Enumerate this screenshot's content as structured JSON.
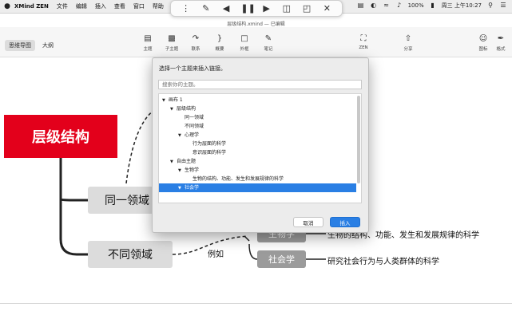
{
  "menubar": {
    "items": [
      "XMind ZEN",
      "文件",
      "编辑",
      "插入",
      "查看",
      "窗口",
      "帮助"
    ],
    "clock": "周三 上午10:27",
    "battery": "100%"
  },
  "window": {
    "title": "层级结构.xmind — 已编辑"
  },
  "toolbar": {
    "view_tabs": [
      "思维导图",
      "大纲"
    ],
    "tools": [
      "主题",
      "子主题",
      "联系",
      "概要",
      "外框",
      "笔记",
      "ZEN",
      "分享",
      "图标",
      "格式"
    ]
  },
  "mindmap": {
    "root": "层级结构",
    "topic1": "同一领域",
    "topic2": "不同领域",
    "relationship_label": "例如",
    "sub1": "生物学",
    "sub1_desc": "生物的结构、功能、发生和发展规律的科学",
    "sub2": "社会学",
    "sub2_desc": "研究社会行为与人类群体的科学"
  },
  "dialog": {
    "prompt": "选择一个主题来插入链接。",
    "search_placeholder": "搜索你的主题。",
    "tree": [
      {
        "label": "画布 1",
        "level": 0,
        "expanded": true
      },
      {
        "label": "层级结构",
        "level": 1,
        "expanded": true
      },
      {
        "label": "同一领域",
        "level": 2
      },
      {
        "label": "不同领域",
        "level": 2
      },
      {
        "label": "心理学",
        "level": 2,
        "expanded": true
      },
      {
        "label": "行为层面的科学",
        "level": 3
      },
      {
        "label": "意识层面的科学",
        "level": 3
      },
      {
        "label": "自由主题",
        "level": 1,
        "expanded": true
      },
      {
        "label": "生物学",
        "level": 2,
        "expanded": true
      },
      {
        "label": "生物的结构、功能、发生和发展规律的科学",
        "level": 3
      },
      {
        "label": "社会学",
        "level": 2,
        "expanded": true,
        "selected": true
      }
    ],
    "cancel_label": "取消",
    "insert_label": "插入"
  },
  "colors": {
    "root": "#e3001b",
    "selection": "#2a7fe4"
  }
}
